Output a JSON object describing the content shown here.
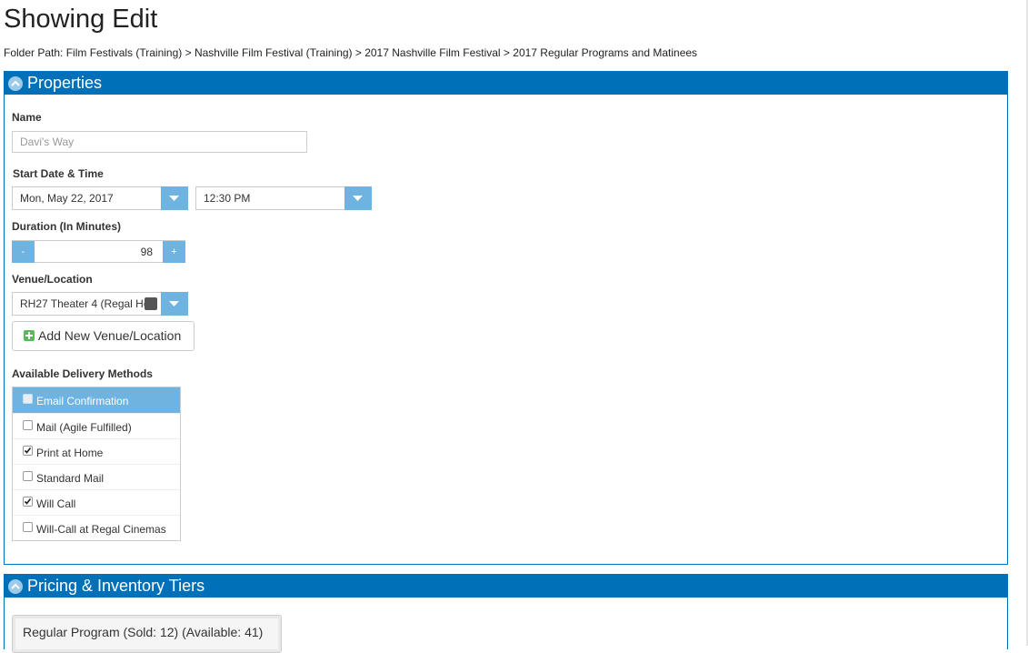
{
  "page": {
    "title": "Showing Edit",
    "breadcrumb": "Folder Path: Film Festivals (Training) > Nashville Film Festival (Training) > 2017 Nashville Film Festival > 2017 Regular Programs and Matinees"
  },
  "properties": {
    "header": "Properties",
    "name_label": "Name",
    "name_placeholder": "Davi's Way",
    "start_label": "Start Date & Time",
    "start_date": "Mon, May 22, 2017",
    "start_time": "12:30 PM",
    "duration_label": "Duration (In Minutes)",
    "duration_value": "98",
    "duration_minus": "-",
    "duration_plus": "+",
    "venue_label": "Venue/Location",
    "venue_value": "RH27 Theater 4 (Regal Ho",
    "add_venue_label": "Add New Venue/Location",
    "delivery_label": "Available Delivery Methods",
    "delivery_methods": [
      {
        "label": "Email Confirmation",
        "checked": false,
        "highlighted": true
      },
      {
        "label": "Mail (Agile Fulfilled)",
        "checked": false,
        "highlighted": false
      },
      {
        "label": "Print at Home",
        "checked": true,
        "highlighted": false
      },
      {
        "label": "Standard Mail",
        "checked": false,
        "highlighted": false
      },
      {
        "label": "Will Call",
        "checked": true,
        "highlighted": false
      },
      {
        "label": "Will-Call at Regal Cinemas",
        "checked": false,
        "highlighted": false
      }
    ]
  },
  "pricing": {
    "header": "Pricing & Inventory Tiers",
    "tier_label": "Regular Program (Sold: 12) (Available: 41)"
  },
  "colors": {
    "panel_blue": "#0070b8",
    "button_blue": "#6fb3e0",
    "add_green": "#5cb85c"
  },
  "icons": {
    "panel_collapse": "chevron-up-circle-icon",
    "dropdown": "caret-down-icon",
    "add": "plus-square-icon",
    "checked": "checkmark-icon"
  }
}
